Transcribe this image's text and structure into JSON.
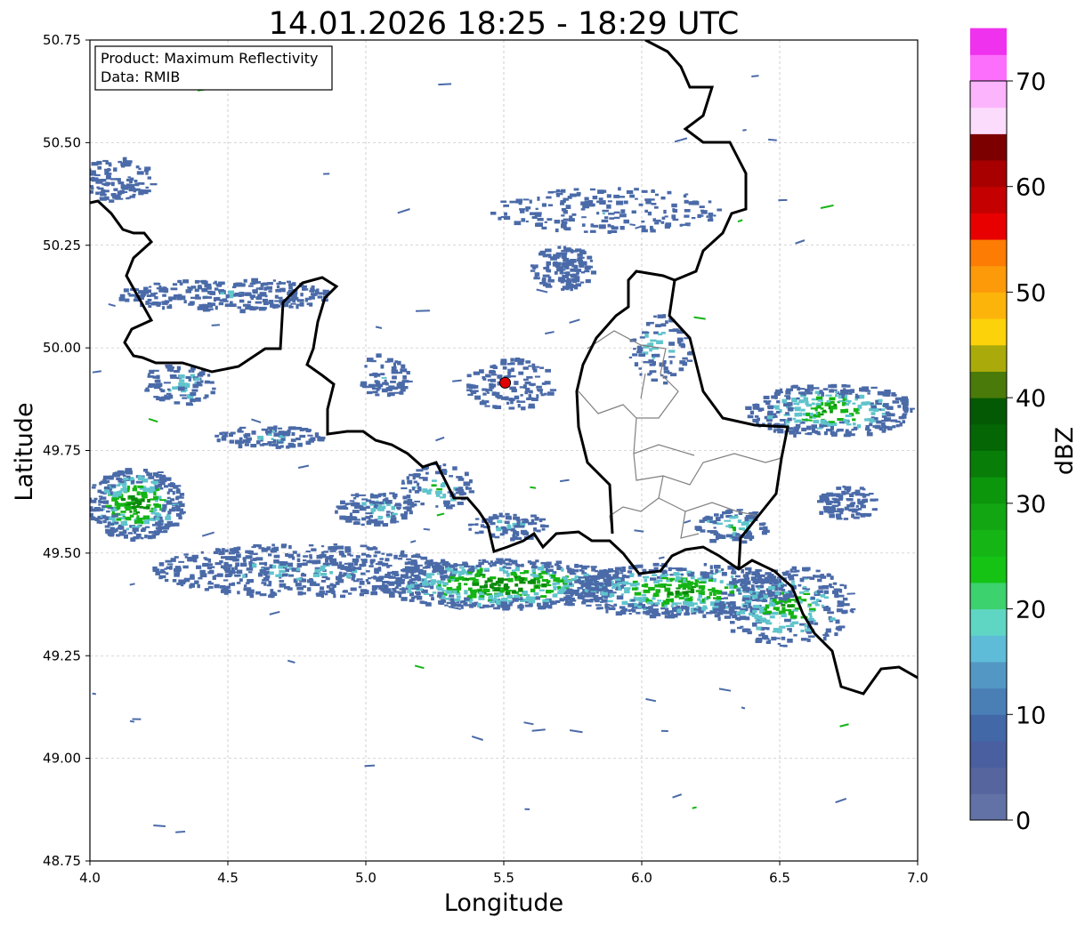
{
  "title": "14.01.2026 18:25 - 18:29 UTC",
  "info_box": {
    "product_line": "Product: Maximum Reflectivity",
    "data_line": "Data: RMIB"
  },
  "axes": {
    "xlabel": "Longitude",
    "ylabel": "Latitude",
    "x_ticks": [
      "4.0",
      "4.5",
      "5.0",
      "5.5",
      "6.0",
      "6.5",
      "7.0"
    ],
    "y_ticks": [
      "50.75",
      "50.50",
      "50.25",
      "50.00",
      "49.75",
      "49.50",
      "49.25",
      "49.00",
      "48.75"
    ],
    "xlim": [
      4.0,
      7.0
    ],
    "ylim": [
      48.75,
      50.75
    ],
    "grid": true
  },
  "colorbar": {
    "label": "dBZ",
    "ticks": [
      "0",
      "10",
      "20",
      "30",
      "40",
      "50",
      "60",
      "70"
    ],
    "range": [
      0,
      70
    ],
    "step": 2.5,
    "colors": [
      "#6272a6",
      "#56659e",
      "#4a5fa0",
      "#4368a8",
      "#4a7fb6",
      "#5398c4",
      "#5fbcd8",
      "#5fd6c4",
      "#3cd26e",
      "#14c314",
      "#16b516",
      "#12a612",
      "#0c960c",
      "#087e08",
      "#056605",
      "#045a04",
      "#4a7a0a",
      "#aaaa0a",
      "#fcd20a",
      "#fcb40a",
      "#fc9a0a",
      "#fc7c04",
      "#e80000",
      "#c40000",
      "#a80000",
      "#7c0000",
      "#fcdcfc",
      "#fcb4fc",
      "#fc6efc",
      "#ee32ee"
    ]
  },
  "radar_site": {
    "lon": 5.505,
    "lat": 49.915,
    "color": "#e00000"
  },
  "echo_colors": {
    "weak": "#4a6aa8",
    "light": "#5fc4cc",
    "moderate": "#14b414",
    "dark": "#0a8a0a"
  },
  "line_colors": {
    "border": "#000000",
    "district": "#808080"
  }
}
